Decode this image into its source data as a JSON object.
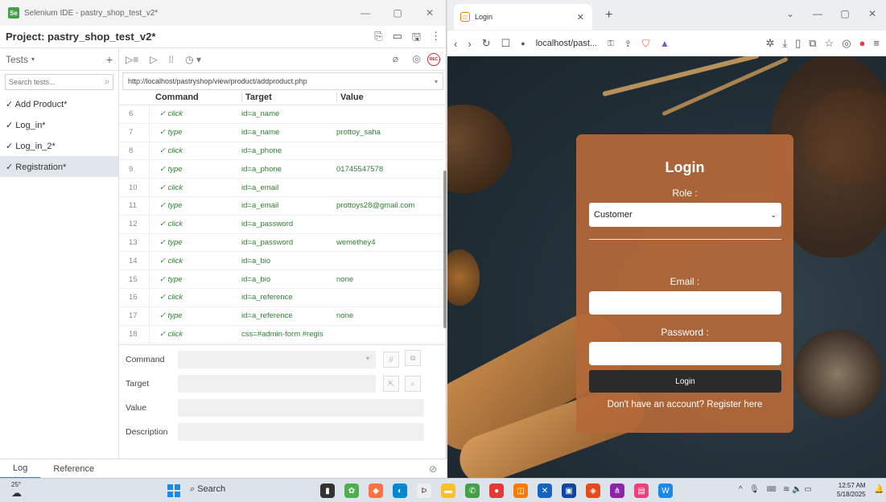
{
  "ide": {
    "window_title": "Selenium IDE - pastry_shop_test_v2*",
    "project_title": "Project: pastry_shop_test_v2*",
    "tests_label": "Tests",
    "search_placeholder": "Search tests...",
    "tests": [
      {
        "label": "✓ Add Product*"
      },
      {
        "label": "✓ Log_in*"
      },
      {
        "label": "✓ Log_in_2*"
      },
      {
        "label": "✓ Registration*",
        "active": true
      }
    ],
    "base_url": "http://localhost/pastryshop/view/product/addproduct.php",
    "rec_label": "REC",
    "columns": {
      "command": "Command",
      "target": "Target",
      "value": "Value"
    },
    "rows": [
      {
        "num": "6",
        "command": "✓ click",
        "target": "id=a_name",
        "value": ""
      },
      {
        "num": "7",
        "command": "✓ type",
        "target": "id=a_name",
        "value": "prottoy_saha"
      },
      {
        "num": "8",
        "command": "✓ click",
        "target": "id=a_phone",
        "value": ""
      },
      {
        "num": "9",
        "command": "✓ type",
        "target": "id=a_phone",
        "value": "01745547578"
      },
      {
        "num": "10",
        "command": "✓ click",
        "target": "id=a_email",
        "value": ""
      },
      {
        "num": "11",
        "command": "✓ type",
        "target": "id=a_email",
        "value": "prottoys28@gmail.com"
      },
      {
        "num": "12",
        "command": "✓ click",
        "target": "id=a_password",
        "value": ""
      },
      {
        "num": "13",
        "command": "✓ type",
        "target": "id=a_password",
        "value": "wemethey4"
      },
      {
        "num": "14",
        "command": "✓ click",
        "target": "id=a_bio",
        "value": ""
      },
      {
        "num": "15",
        "command": "✓ type",
        "target": "id=a_bio",
        "value": "none"
      },
      {
        "num": "16",
        "command": "✓ click",
        "target": "id=a_reference",
        "value": ""
      },
      {
        "num": "17",
        "command": "✓ type",
        "target": "id=a_reference",
        "value": "none"
      },
      {
        "num": "18",
        "command": "✓ click",
        "target": "css=#admin-form #regis",
        "value": ""
      }
    ],
    "editor": {
      "command_label": "Command",
      "target_label": "Target",
      "value_label": "Value",
      "description_label": "Description"
    },
    "bottom_tabs": {
      "log": "Log",
      "reference": "Reference"
    }
  },
  "browser": {
    "tab_title": "Login",
    "address": "localhost/past...",
    "login": {
      "title": "Login",
      "role_label": "Role :",
      "role_selected": "Customer",
      "email_label": "Email :",
      "password_label": "Password :",
      "button": "Login",
      "register_link": "Don't have an account? Register here"
    }
  },
  "taskbar": {
    "weather": "25°",
    "search": "Search",
    "time": "12:57 AM",
    "date": "5/18/2025"
  },
  "colors": {
    "card": "#b56839",
    "selenium_green": "#2e7d32",
    "rec_red": "#c62828"
  }
}
